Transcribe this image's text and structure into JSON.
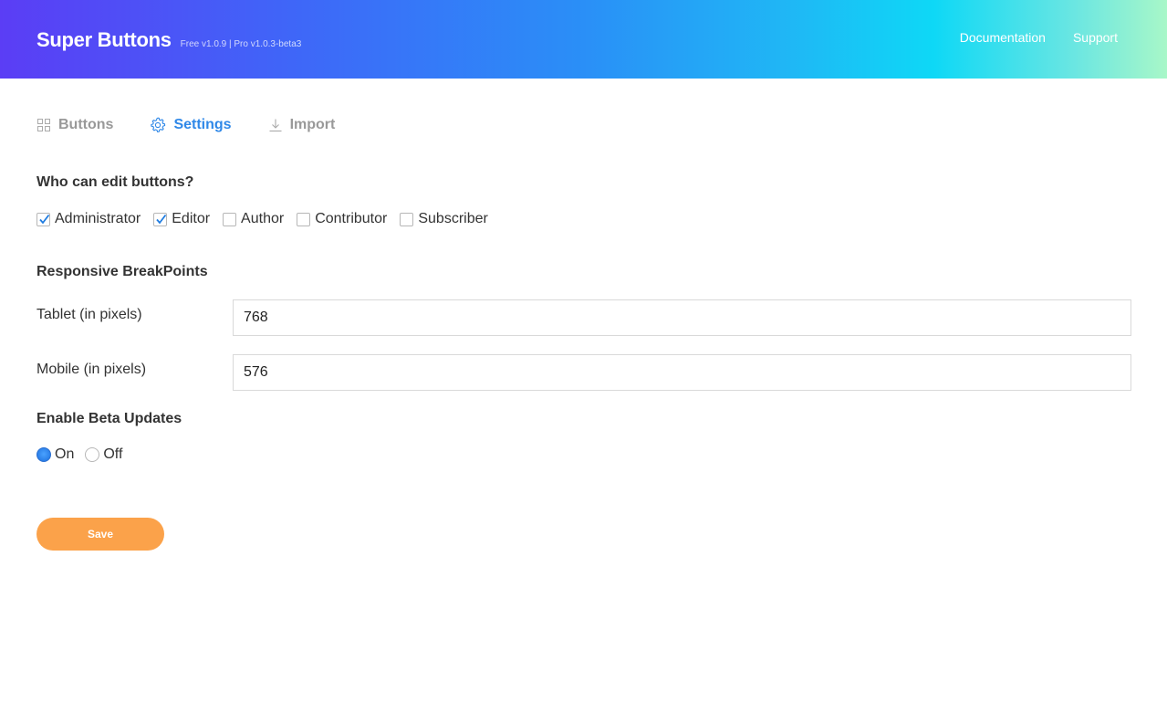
{
  "app": {
    "title": "Super Buttons",
    "version": "Free v1.0.9 | Pro v1.0.3-beta3"
  },
  "top_nav": [
    "Documentation",
    "Support"
  ],
  "tabs": [
    {
      "label": "Buttons",
      "icon": "grid-icon",
      "active": false
    },
    {
      "label": "Settings",
      "icon": "gear-icon",
      "active": true
    },
    {
      "label": "Import",
      "icon": "download-icon",
      "active": false
    }
  ],
  "who_can_edit": {
    "title": "Who can edit buttons?",
    "roles": [
      {
        "label": "Administrator",
        "checked": true
      },
      {
        "label": "Editor",
        "checked": true
      },
      {
        "label": "Author",
        "checked": false
      },
      {
        "label": "Contributor",
        "checked": false
      },
      {
        "label": "Subscriber",
        "checked": false
      }
    ]
  },
  "breakpoints": {
    "title": "Responsive BreakPoints",
    "tablet": {
      "label": "Tablet (in pixels)",
      "value": "768"
    },
    "mobile": {
      "label": "Mobile (in pixels)",
      "value": "576"
    }
  },
  "beta_updates": {
    "title": "Enable Beta Updates",
    "options": [
      {
        "label": "On",
        "selected": true
      },
      {
        "label": "Off",
        "selected": false
      }
    ]
  },
  "save_label": "Save",
  "colors": {
    "accent": "#2f88e8",
    "save_button": "#fba24a",
    "header_gradient_start": "#5b3df5",
    "header_gradient_end": "#a8f7c8"
  }
}
